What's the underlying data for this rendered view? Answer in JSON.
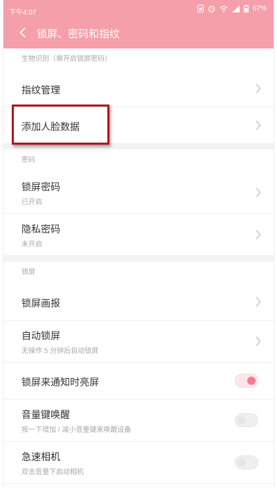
{
  "status_bar": {
    "time": "下午4:07",
    "battery": "67%",
    "icons": [
      "sim-icon",
      "alarm-icon",
      "wifi-icon",
      "signal-icon",
      "battery-icon"
    ]
  },
  "header": {
    "title": "锁屏、密码和指纹",
    "back_icon": "chevron-left-icon",
    "background_color": "#f59faa"
  },
  "sections": [
    {
      "header": "生物识别（需开启锁屏密码）",
      "items": [
        {
          "title": "指纹管理",
          "control": "chevron"
        },
        {
          "title": "添加人脸数据",
          "control": "chevron",
          "highlighted": true
        }
      ]
    },
    {
      "header": "密码",
      "items": [
        {
          "title": "锁屏密码",
          "subtitle": "已开启",
          "control": "chevron"
        },
        {
          "title": "隐私密码",
          "subtitle": "未开启",
          "control": "chevron"
        }
      ]
    },
    {
      "header": "锁屏",
      "items": [
        {
          "title": "锁屏画报",
          "control": "chevron"
        },
        {
          "title": "自动锁屏",
          "subtitle": "无操作 5 分钟后自动锁屏",
          "control": "chevron"
        },
        {
          "title": "锁屏来通知时亮屏",
          "control": "toggle",
          "on": true
        },
        {
          "title": "音量键唤醒",
          "subtitle": "按一下增加 / 减小音量键来唤醒设备",
          "control": "toggle",
          "on": false
        },
        {
          "title": "急速相机",
          "subtitle": "双击音量下启动相机",
          "control": "toggle",
          "on": false
        }
      ]
    }
  ],
  "colors": {
    "accent": "#f47b8d",
    "highlight_border": "#b0151c"
  }
}
